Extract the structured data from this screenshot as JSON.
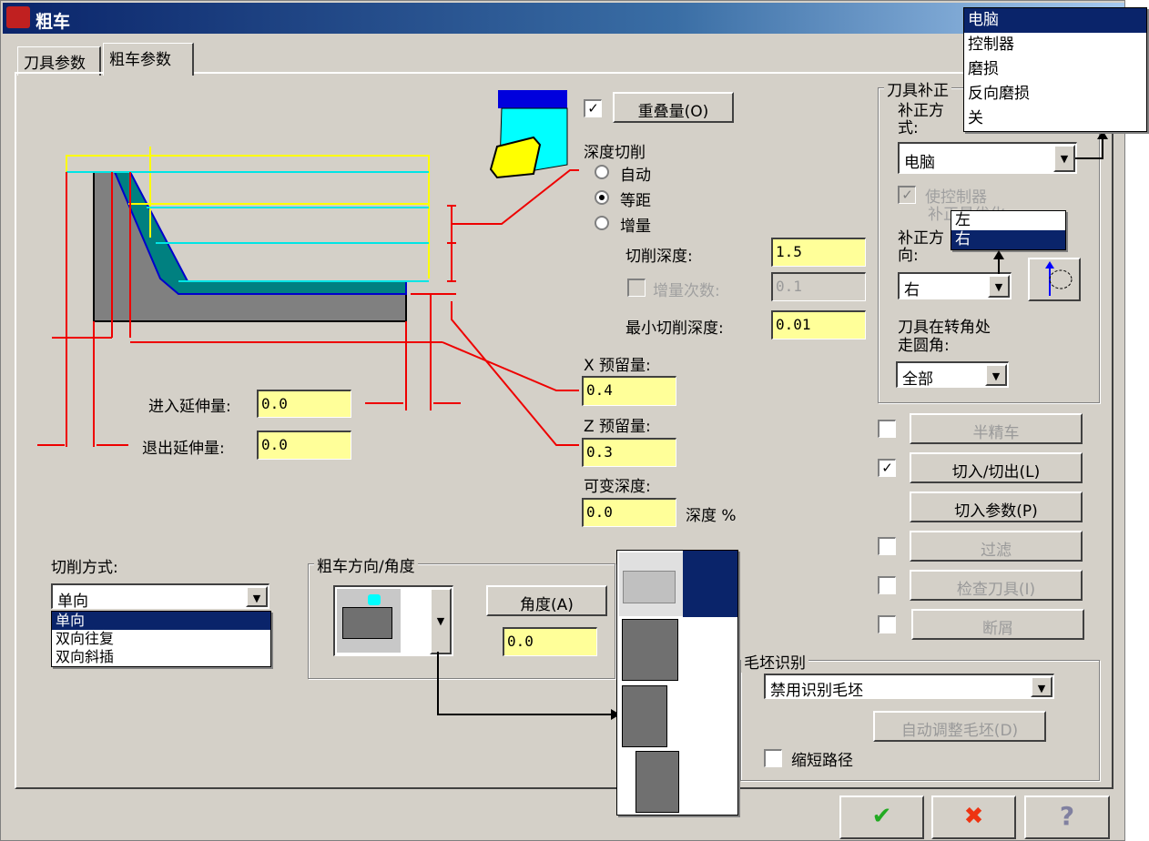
{
  "window": {
    "title": "粗车",
    "tabs": [
      "刀具参数",
      "粗车参数"
    ]
  },
  "depth_cut": {
    "overlap_checked": true,
    "overlap_button": "重叠量(O)",
    "label": "深度切削",
    "options": [
      "自动",
      "等距",
      "增量"
    ],
    "selected": "等距",
    "cut_depth_label": "切削深度:",
    "cut_depth": "1.5",
    "incr_label": "增量次数:",
    "incr_value": "0.1",
    "min_depth_label": "最小切削深度:",
    "min_depth": "0.01"
  },
  "stock": {
    "x_label": "X 预留量:",
    "x_value": "0.4",
    "z_label": "Z 预留量:",
    "z_value": "0.3",
    "var_label": "可变深度:",
    "var_value": "0.0",
    "var_unit": "深度 %"
  },
  "extension": {
    "entry_label": "进入延伸量:",
    "entry_value": "0.0",
    "exit_label": "退出延伸量:",
    "exit_value": "0.0"
  },
  "cut_method": {
    "label": "切削方式:",
    "value": "单向",
    "options": [
      "单向",
      "双向往复",
      "双向斜插"
    ]
  },
  "direction": {
    "group": "粗车方向/角度",
    "angle_button": "角度(A)",
    "angle_value": "0.0"
  },
  "comp": {
    "group": "刀具补正",
    "type_label": "补正方式:",
    "type_value": "电脑",
    "type_options": [
      "电脑",
      "控制器",
      "磨损",
      "反向磨损",
      "关"
    ],
    "ctrl_opt": "使控制器",
    "ctrl_opt2": "补正量优化",
    "dir_label": "补正方向:",
    "dir_value": "右",
    "dir_options": [
      "左",
      "右"
    ],
    "corner_label": "刀具在转角处走圆角:",
    "corner_value": "全部"
  },
  "options": [
    {
      "label": "半精车",
      "checked": false,
      "has_cb": true
    },
    {
      "label": "切入/切出(L)",
      "checked": true,
      "has_cb": true,
      "enabled": true
    },
    {
      "label": "切入参数(P)",
      "has_cb": false,
      "enabled": true
    },
    {
      "label": "过滤",
      "checked": false,
      "has_cb": true
    },
    {
      "label": "检查刀具(I)",
      "checked": false,
      "has_cb": true
    },
    {
      "label": "断屑",
      "checked": false,
      "has_cb": true
    }
  ],
  "stock_recog": {
    "group": "毛坯识别",
    "value": "禁用识别毛坯",
    "auto_button": "自动调整毛坯(D)",
    "shorten_label": "缩短路径"
  },
  "footer": {
    "ok": "✔",
    "cancel": "✖",
    "help": "?"
  }
}
